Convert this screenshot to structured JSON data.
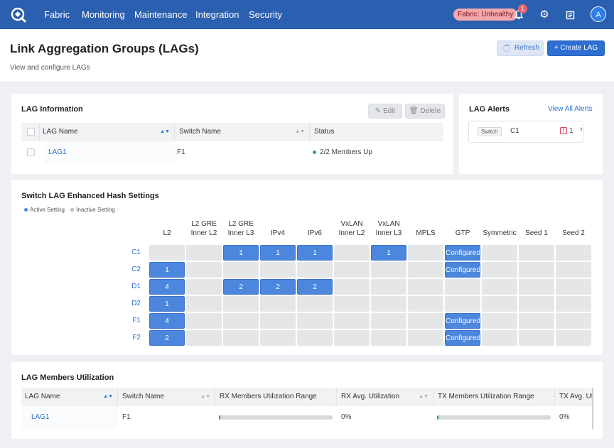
{
  "nav": {
    "items": [
      "Fabric",
      "Monitoring",
      "Maintenance",
      "Integration",
      "Security"
    ],
    "health": "Fabric: Unhealthy",
    "notifications": "1",
    "avatar": "A"
  },
  "header": {
    "title": "Link Aggregation Groups (LAGs)",
    "subtitle": "View and configure LAGs",
    "refresh": "Refresh",
    "create": "+ Create LAG"
  },
  "lag_info": {
    "title": "LAG Information",
    "edit": "Edit",
    "delete": "Delete",
    "columns": [
      "LAG Name",
      "Switch Name",
      "Status"
    ],
    "rows": [
      {
        "name": "LAG1",
        "switch": "F1",
        "status": "2/2 Members Up"
      }
    ]
  },
  "lag_alerts": {
    "title": "LAG Alerts",
    "view_all": "View All Alerts",
    "items": [
      {
        "tag": "Switch",
        "name": "C1",
        "count": "1"
      }
    ]
  },
  "hash": {
    "title": "Switch LAG Enhanced Hash Settings",
    "legend_active": "Active Setting",
    "legend_inactive": "Inactive Setting",
    "columns": [
      "L2",
      "L2 GRE\nInner L2",
      "L2 GRE\nInner L3",
      "IPv4",
      "IPv6",
      "VxLAN\nInner L2",
      "VxLAN\nInner L3",
      "MPLS",
      "GTP",
      "Symmetric",
      "Seed 1",
      "Seed 2"
    ],
    "rows": [
      {
        "label": "C1",
        "cells": [
          "",
          "",
          "1",
          "1",
          "1",
          "",
          "1",
          "",
          "Configured",
          "",
          "",
          ""
        ]
      },
      {
        "label": "C2",
        "cells": [
          "1",
          "",
          "",
          "",
          "",
          "",
          "",
          "",
          "Configured",
          "",
          "",
          ""
        ]
      },
      {
        "label": "D1",
        "cells": [
          "4",
          "",
          "2",
          "2",
          "2",
          "",
          "",
          "",
          "",
          "",
          "",
          ""
        ]
      },
      {
        "label": "D2",
        "cells": [
          "1",
          "",
          "",
          "",
          "",
          "",
          "",
          "",
          "",
          "",
          "",
          ""
        ]
      },
      {
        "label": "F1",
        "cells": [
          "4",
          "",
          "",
          "",
          "",
          "",
          "",
          "",
          "Configured",
          "",
          "",
          ""
        ]
      },
      {
        "label": "F2",
        "cells": [
          "2",
          "",
          "",
          "",
          "",
          "",
          "",
          "",
          "Configured",
          "",
          "",
          ""
        ]
      }
    ]
  },
  "members": {
    "title": "LAG Members Utilization",
    "columns": [
      "LAG Name",
      "Switch Name",
      "RX Members Utilization Range",
      "RX Avg. Utilization",
      "TX Members Utilization Range",
      "TX Avg. Ut"
    ],
    "rows": [
      {
        "name": "LAG1",
        "switch": "F1",
        "rx_range": 0.01,
        "rx_avg": "0%",
        "tx_range": 0.01,
        "tx_avg": "0%"
      }
    ]
  }
}
